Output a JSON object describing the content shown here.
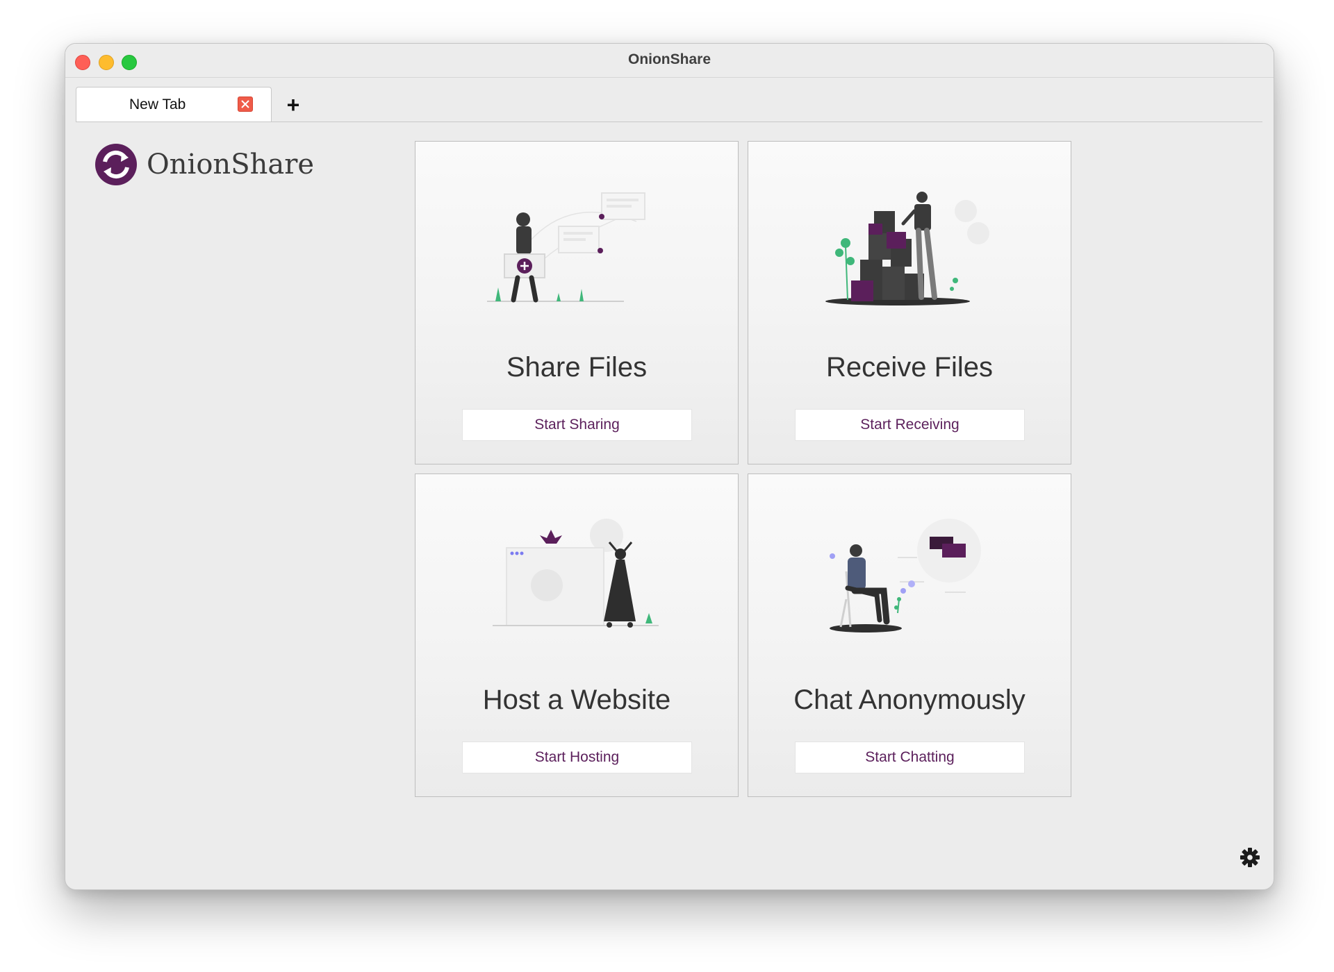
{
  "window": {
    "title": "OnionShare"
  },
  "tabs": [
    {
      "label": "New Tab"
    }
  ],
  "new_tab_label": "+",
  "logo": {
    "text": "OnionShare"
  },
  "cards": [
    {
      "title": "Share Files",
      "button": "Start Sharing"
    },
    {
      "title": "Receive Files",
      "button": "Start Receiving"
    },
    {
      "title": "Host a Website",
      "button": "Start Hosting"
    },
    {
      "title": "Chat Anonymously",
      "button": "Start Chatting"
    }
  ],
  "colors": {
    "brand_purple": "#5b1f5b",
    "accent_green": "#3fb77a",
    "card_border": "#bdbdbd"
  },
  "icons": {
    "settings": "gear-icon",
    "close_tab": "close-tab-icon"
  }
}
